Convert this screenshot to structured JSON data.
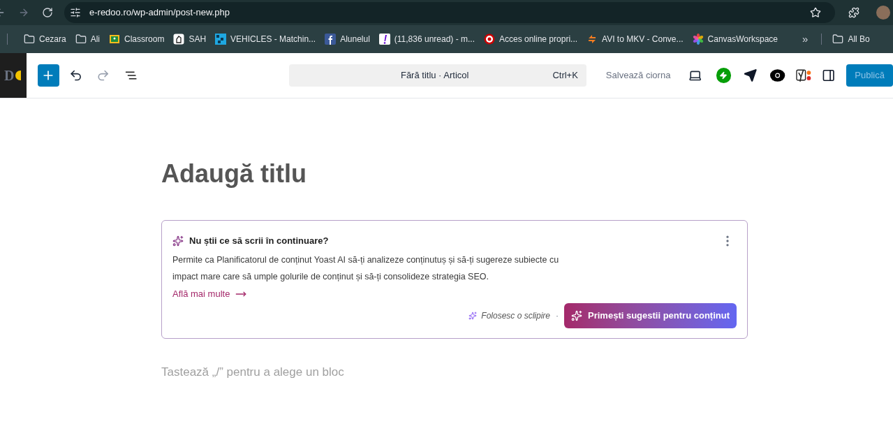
{
  "browser": {
    "url": "e-redoo.ro/wp-admin/post-new.php",
    "bookmarks": [
      {
        "label": "Cezara",
        "kind": "folder"
      },
      {
        "label": "Ali",
        "kind": "folder"
      },
      {
        "label": "Classroom",
        "kind": "classroom"
      },
      {
        "label": "SAH",
        "kind": "chess"
      },
      {
        "label": "VEHICLES - Matchin...",
        "kind": "grid"
      },
      {
        "label": "Alunelul",
        "kind": "facebook"
      },
      {
        "label": "(11,836 unread) - m...",
        "kind": "yahoo"
      },
      {
        "label": "Acces online propri...",
        "kind": "target"
      },
      {
        "label": "AVI to MKV - Conve...",
        "kind": "convert"
      },
      {
        "label": "CanvasWorkspace",
        "kind": "flower"
      }
    ],
    "more": "»",
    "all_bookmarks": "All Bo"
  },
  "editor": {
    "logo_text": "D",
    "command": {
      "title": "Fără titlu · Articol",
      "shortcut": "Ctrl+K"
    },
    "save_draft": "Salvează ciorna",
    "publish": "Publică",
    "title_placeholder": "Adaugă titlu",
    "block_placeholder": "Tastează „/” pentru a alege un bloc"
  },
  "yoast_card": {
    "heading": "Nu știi ce să scrii în continuare?",
    "body": "Permite ca Planificatorul de conținut Yoast AI să-ți analizeze conținutuș și să-ți sugereze subiecte cu impact mare care să umple golurile de conținut și să-ți consolideze strategia SEO.",
    "link": "Află mai multe",
    "spark_note": "Folosesc o sclipire",
    "separator": "·",
    "button": "Primești sugestii pentru conținut"
  }
}
